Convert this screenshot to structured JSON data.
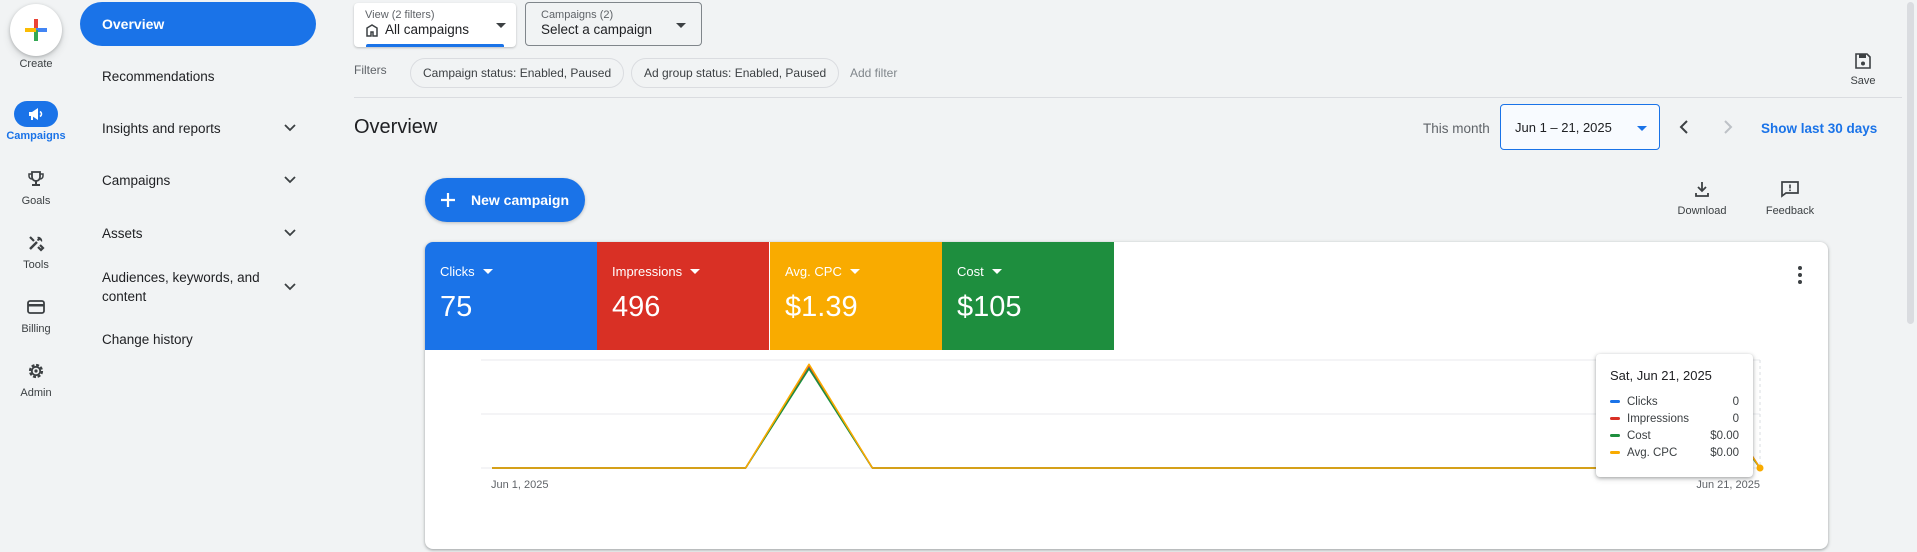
{
  "rail": {
    "create": "Create",
    "items": [
      {
        "label": "Campaigns",
        "icon": "megaphone-icon"
      },
      {
        "label": "Goals",
        "icon": "trophy-icon"
      },
      {
        "label": "Tools",
        "icon": "tools-icon"
      },
      {
        "label": "Billing",
        "icon": "credit-card-icon"
      },
      {
        "label": "Admin",
        "icon": "gear-icon"
      }
    ]
  },
  "nav": {
    "items": [
      {
        "label": "Overview",
        "active": true
      },
      {
        "label": "Recommendations"
      },
      {
        "label": "Insights and reports",
        "expandable": true
      },
      {
        "label": "Campaigns",
        "expandable": true
      },
      {
        "label": "Assets",
        "expandable": true
      },
      {
        "label": "Audiences, keywords, and content",
        "expandable": true
      },
      {
        "label": "Change history"
      }
    ]
  },
  "toolbar": {
    "view_small": "View (2 filters)",
    "view_value": "All campaigns",
    "campaigns_small": "Campaigns (2)",
    "campaigns_value": "Select a campaign",
    "filters_label": "Filters",
    "chips": [
      "Campaign status: Enabled, Paused",
      "Ad group status: Enabled, Paused"
    ],
    "add_filter": "Add filter",
    "save": "Save"
  },
  "header": {
    "title": "Overview",
    "this_month": "This month",
    "date_range": "Jun 1 – 21, 2025",
    "show_last": "Show last 30 days"
  },
  "actions": {
    "new_campaign": "New campaign",
    "download": "Download",
    "feedback": "Feedback"
  },
  "metrics": [
    {
      "name": "Clicks",
      "value": "75",
      "color": "#1a73e8"
    },
    {
      "name": "Impressions",
      "value": "496",
      "color": "#d93025"
    },
    {
      "name": "Avg. CPC",
      "value": "$1.39",
      "color": "#f9ab00"
    },
    {
      "name": "Cost",
      "value": "$105",
      "color": "#1e8e3e"
    }
  ],
  "chart_data": {
    "type": "line",
    "x": [
      "Jun 1, 2025",
      "Jun 2, 2025",
      "Jun 3, 2025",
      "Jun 4, 2025",
      "Jun 5, 2025",
      "Jun 6, 2025",
      "Jun 7, 2025",
      "Jun 8, 2025",
      "Jun 9, 2025",
      "Jun 10, 2025",
      "Jun 11, 2025",
      "Jun 12, 2025",
      "Jun 13, 2025",
      "Jun 14, 2025",
      "Jun 15, 2025",
      "Jun 16, 2025",
      "Jun 17, 2025",
      "Jun 18, 2025",
      "Jun 19, 2025",
      "Jun 20, 2025",
      "Jun 21, 2025"
    ],
    "x_tick_labels": [
      "Jun 1, 2025",
      "Jun 21, 2025"
    ],
    "normalized": true,
    "series": [
      {
        "name": "Clicks",
        "color": "#1a73e8",
        "values": [
          0,
          0,
          0,
          0,
          0,
          0.93,
          0,
          0,
          0,
          0,
          0,
          0,
          0,
          0,
          0,
          0,
          0,
          0,
          0,
          0.85,
          0
        ]
      },
      {
        "name": "Impressions",
        "color": "#d93025",
        "values": [
          0,
          0,
          0,
          0,
          0,
          0.95,
          0,
          0,
          0,
          0,
          0,
          0,
          0,
          0,
          0,
          0,
          0,
          0,
          0,
          0.9,
          0
        ]
      },
      {
        "name": "Cost",
        "color": "#1e8e3e",
        "values": [
          0,
          0,
          0,
          0,
          0,
          0.92,
          0,
          0,
          0,
          0,
          0,
          0,
          0,
          0,
          0,
          0,
          0,
          0,
          0,
          0.8,
          0
        ]
      },
      {
        "name": "Avg. CPC",
        "color": "#f9ab00",
        "values": [
          0,
          0,
          0,
          0,
          0,
          0.96,
          0,
          0,
          0,
          0,
          0,
          0,
          0,
          0,
          0,
          0,
          0,
          0,
          0,
          0.88,
          0
        ]
      }
    ],
    "ylim": [
      0,
      1
    ],
    "grid": true
  },
  "tooltip": {
    "title": "Sat, Jun 21, 2025",
    "rows": [
      {
        "name": "Clicks",
        "value": "0",
        "color": "#1a73e8"
      },
      {
        "name": "Impressions",
        "value": "0",
        "color": "#d93025"
      },
      {
        "name": "Cost",
        "value": "$0.00",
        "color": "#1e8e3e"
      },
      {
        "name": "Avg. CPC",
        "value": "$0.00",
        "color": "#f9ab00"
      }
    ]
  }
}
